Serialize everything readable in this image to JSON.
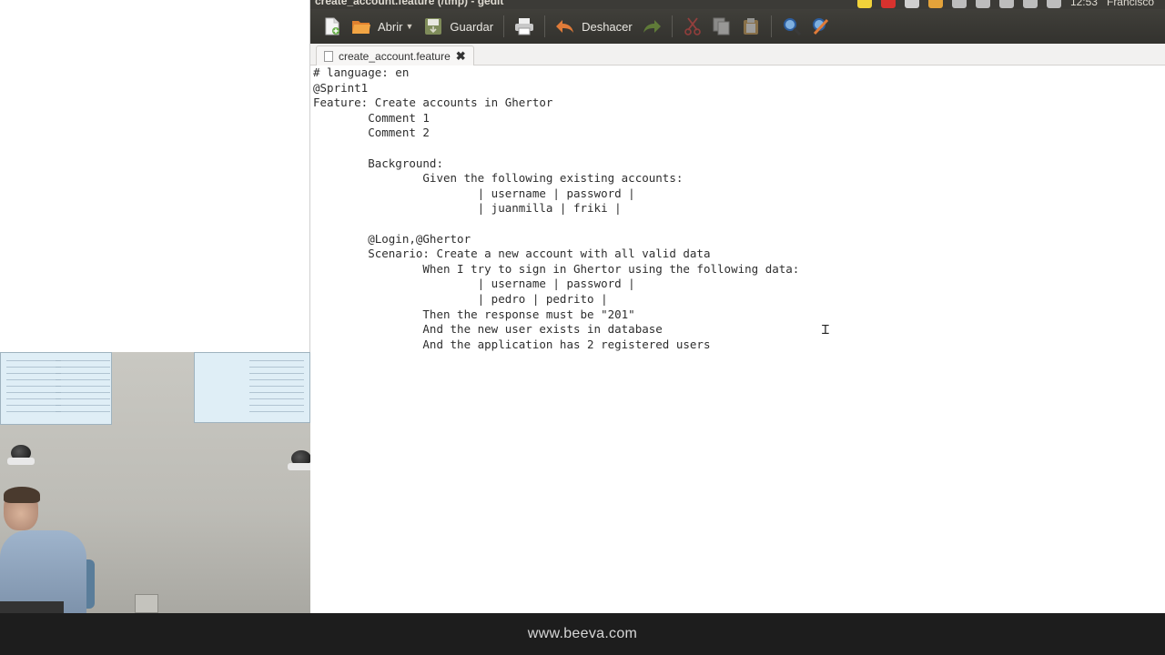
{
  "window": {
    "title": "create_account.feature (/tmp) - gedit",
    "panel_time": "12:53",
    "panel_user": "Francisco"
  },
  "toolbar": {
    "new_icon": "new-document-icon",
    "open_label": "Abrir",
    "save_label": "Guardar",
    "print_icon": "printer-icon",
    "undo_label": "Deshacer",
    "redo_icon": "redo-arrow-icon",
    "cut_icon": "scissors-icon",
    "copy_icon": "copy-icon",
    "paste_icon": "paste-icon",
    "search_icon": "magnifier-icon",
    "replace_icon": "replace-icon"
  },
  "tab": {
    "label": "create_account.feature",
    "close_icon": "close-x-icon"
  },
  "editor": {
    "lines": [
      "# language: en",
      "@Sprint1",
      "Feature: Create accounts in Ghertor",
      "        Comment 1",
      "        Comment 2",
      "",
      "        Background:",
      "                Given the following existing accounts:",
      "                        | username | password |",
      "                        | juanmilla | friki |",
      "",
      "        @Login,@Ghertor",
      "        Scenario: Create a new account with all valid data",
      "                When I try to sign in Ghertor using the following data:",
      "                        | username | password |",
      "                        | pedro | pedrito |",
      "                Then the response must be \"201\"",
      "                And the new user exists in database",
      "                And the application has 2 registered users"
    ]
  },
  "footer": {
    "url": "www.beeva.com"
  },
  "colors": {
    "toolbar_bg": "#3c3b37",
    "editor_bg": "#ffffff",
    "footer_bg": "#1d1d1d"
  }
}
